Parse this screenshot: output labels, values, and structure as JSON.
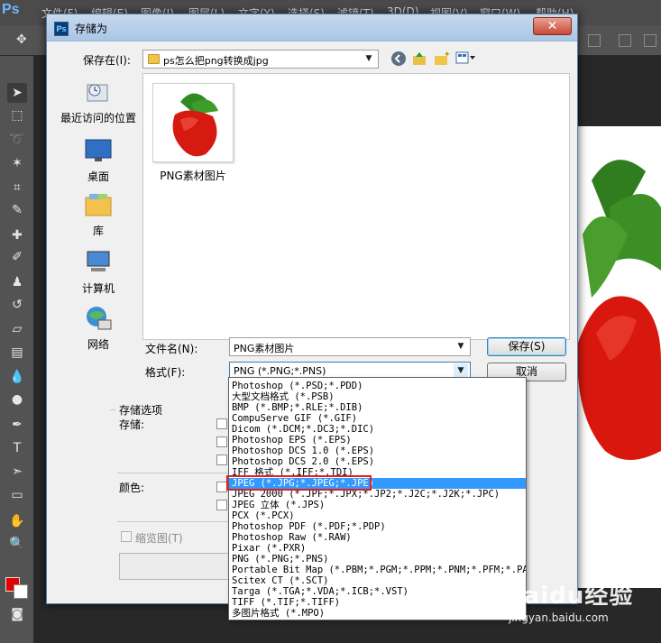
{
  "photoshop": {
    "logo": "Ps",
    "menus": [
      "文件(F)",
      "编辑(E)",
      "图像(I)",
      "图层(L)",
      "文字(Y)",
      "选择(S)",
      "滤镜(T)",
      "3D(D)",
      "视图(V)",
      "窗口(W)",
      "帮助(H)"
    ],
    "watermark_main": "Baidu经验",
    "watermark_sub": "jingyan.baidu.com",
    "fg_color": "#e40000",
    "bg_color": "#ffffff"
  },
  "dialog": {
    "title": "存储为",
    "close_label": "✕",
    "save_in_label": "保存在(I):",
    "save_in_value": "ps怎么把png转换成jpg",
    "places": [
      {
        "label": "最近访问的位置",
        "icon": "recent-places-icon"
      },
      {
        "label": "桌面",
        "icon": "desktop-icon"
      },
      {
        "label": "库",
        "icon": "library-icon"
      },
      {
        "label": "计算机",
        "icon": "computer-icon"
      },
      {
        "label": "网络",
        "icon": "network-icon"
      }
    ],
    "files": [
      {
        "name": "PNG素材图片",
        "icon": "strawberry-thumbnail"
      }
    ],
    "filename_label": "文件名(N):",
    "filename_value": "PNG素材图片",
    "format_label": "格式(F):",
    "format_value": "PNG (*.PNG;*.PNS)",
    "save_button": "保存(S)",
    "cancel_button": "取消",
    "options_title": "存储选项",
    "store_label": "存储:",
    "color_label": "颜色:",
    "thumbnail_label": "缩览图(T)"
  },
  "format_dropdown": {
    "selected_index": 9,
    "items": [
      "Photoshop (*.PSD;*.PDD)",
      "大型文档格式 (*.PSB)",
      "BMP (*.BMP;*.RLE;*.DIB)",
      "CompuServe GIF (*.GIF)",
      "Dicom (*.DCM;*.DC3;*.DIC)",
      "Photoshop EPS (*.EPS)",
      "Photoshop DCS 1.0 (*.EPS)",
      "Photoshop DCS 2.0 (*.EPS)",
      "IFF 格式 (*.IFF;*.TDI)",
      "JPEG (*.JPG;*.JPEG;*.JPE)",
      "JPEG 2000 (*.JPF;*.JPX;*.JP2;*.J2C;*.J2K;*.JPC)",
      "JPEG 立体 (*.JPS)",
      "PCX (*.PCX)",
      "Photoshop PDF (*.PDF;*.PDP)",
      "Photoshop Raw (*.RAW)",
      "Pixar (*.PXR)",
      "PNG (*.PNG;*.PNS)",
      "Portable Bit Map (*.PBM;*.PGM;*.PPM;*.PNM;*.PFM;*.PAM)",
      "Scitex CT (*.SCT)",
      "Targa (*.TGA;*.VDA;*.ICB;*.VST)",
      "TIFF (*.TIF;*.TIFF)",
      "多图片格式 (*.MPO)"
    ]
  }
}
